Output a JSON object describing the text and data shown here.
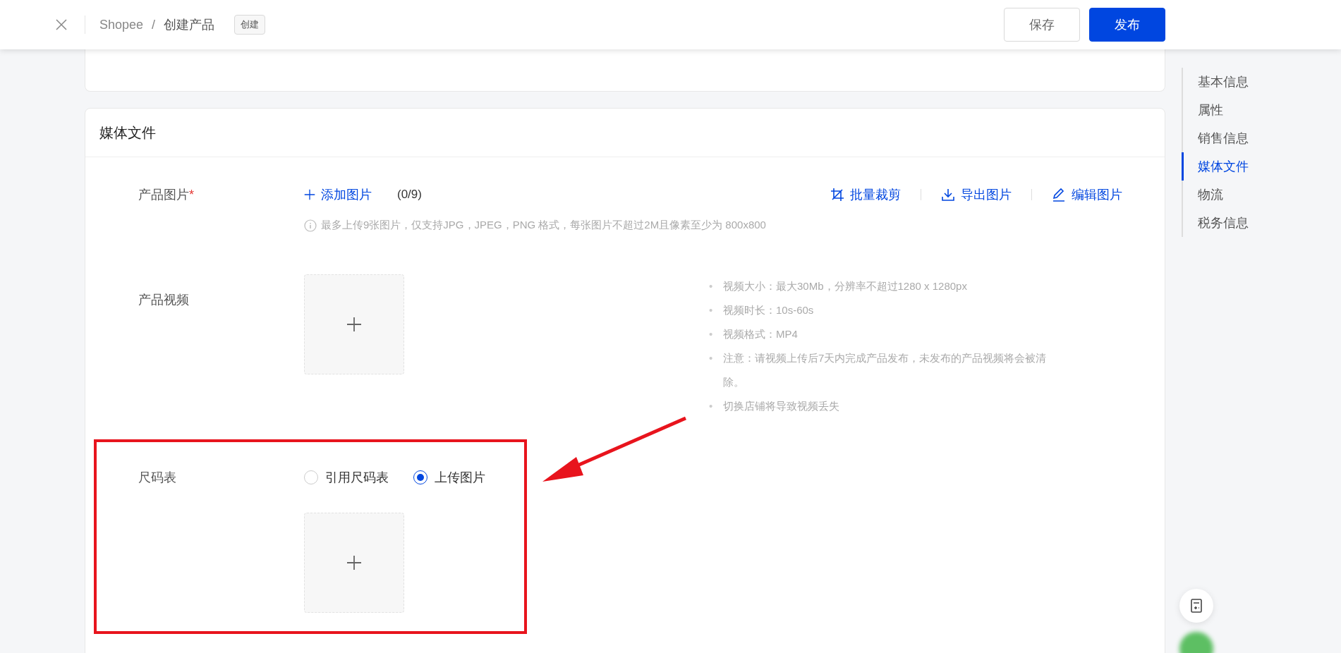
{
  "header": {
    "breadcrumb": [
      "Shopee",
      "创建产品"
    ],
    "separator": "/",
    "tag": "创建",
    "buttons": [
      {
        "label": "保存",
        "kind": "default"
      },
      {
        "label": "发布",
        "kind": "primary"
      }
    ]
  },
  "section": {
    "title": "媒体文件",
    "product_images": {
      "label": "产品图片",
      "required_mark": "*",
      "add_label": "添加图片",
      "count": "(0/9)",
      "actions": [
        {
          "label": "批量裁剪",
          "kind": "crop"
        },
        {
          "label": "导出图片",
          "kind": "export"
        },
        {
          "label": "编辑图片",
          "kind": "edit"
        }
      ],
      "hint": "最多上传9张图片，仅支持JPG，JPEG，PNG 格式，每张图片不超过2M且像素至少为 800x800"
    },
    "product_video": {
      "label": "产品视频",
      "bullet": "•",
      "notes": [
        "视频大小：最大30Mb，分辨率不超过1280 x 1280px",
        "视频时长：10s-60s",
        "视频格式：MP4",
        "注意：请视频上传后7天内完成产品发布，未发布的产品视频将会被清除。",
        "切换店铺将导致视频丢失"
      ]
    },
    "size_chart": {
      "label": "尺码表",
      "options": [
        {
          "label": "引用尺码表",
          "selected": false
        },
        {
          "label": "上传图片",
          "selected": true
        }
      ]
    }
  },
  "nav": [
    {
      "label": "基本信息",
      "selected": false
    },
    {
      "label": "属性",
      "selected": false
    },
    {
      "label": "销售信息",
      "selected": false
    },
    {
      "label": "媒体文件",
      "selected": true
    },
    {
      "label": "物流",
      "selected": false
    },
    {
      "label": "税务信息",
      "selected": false
    }
  ]
}
